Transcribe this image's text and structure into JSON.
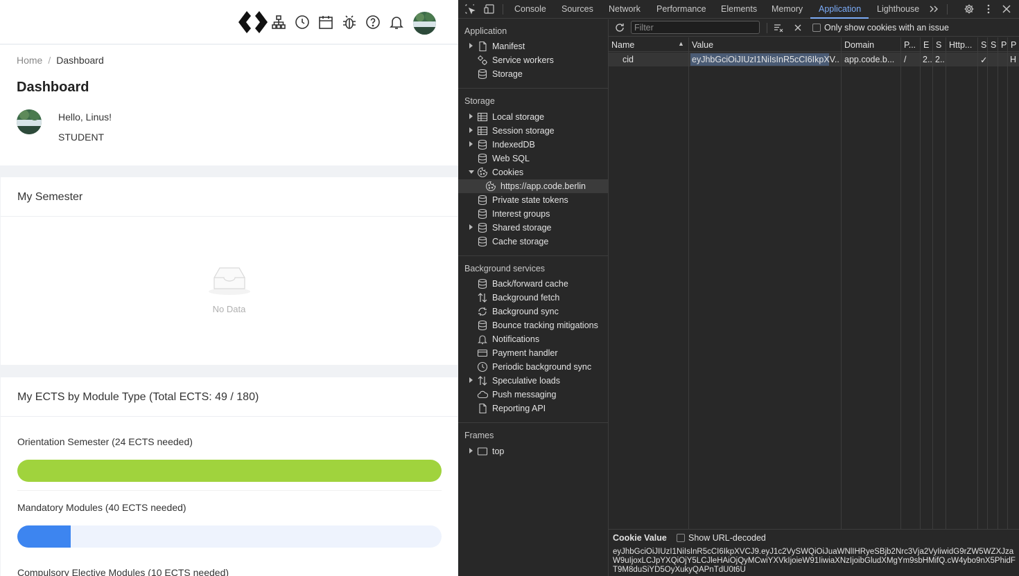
{
  "app": {
    "breadcrumb": {
      "home": "Home",
      "separator": "/",
      "current": "Dashboard"
    },
    "page_title": "Dashboard",
    "profile": {
      "greeting": "Hello, Linus!",
      "role": "STUDENT"
    },
    "semester_card": {
      "title": "My Semester",
      "empty_text": "No Data"
    },
    "ects_card": {
      "title": "My ECTS by Module Type (Total ECTS: 49 / 180)",
      "modules": [
        {
          "label": "Orientation Semester (24 ECTS needed)",
          "progress": 1.0,
          "color": "#a0d33d"
        },
        {
          "label": "Mandatory Modules (40 ECTS needed)",
          "progress": 0.125,
          "color": "#3d85f0"
        },
        {
          "label": "Compulsory Elective Modules (10 ECTS needed)"
        }
      ]
    },
    "colors": {
      "accent_green": "#a0d33d",
      "accent_blue": "#3d85f0",
      "bar_track": "#eef3fd"
    }
  },
  "devtools": {
    "tabs": [
      "Console",
      "Sources",
      "Network",
      "Performance",
      "Elements",
      "Memory",
      "Application",
      "Lighthouse"
    ],
    "active_tab": "Application",
    "sidebar": {
      "application": {
        "title": "Application",
        "items": [
          "Manifest",
          "Service workers",
          "Storage"
        ]
      },
      "storage": {
        "title": "Storage",
        "items": [
          "Local storage",
          "Session storage",
          "IndexedDB",
          "Web SQL",
          "Cookies",
          "https://app.code.berlin",
          "Private state tokens",
          "Interest groups",
          "Shared storage",
          "Cache storage"
        ]
      },
      "background": {
        "title": "Background services",
        "items": [
          "Back/forward cache",
          "Background fetch",
          "Background sync",
          "Bounce tracking mitigations",
          "Notifications",
          "Payment handler",
          "Periodic background sync",
          "Speculative loads",
          "Push messaging",
          "Reporting API"
        ]
      },
      "frames": {
        "title": "Frames",
        "items": [
          "top"
        ]
      }
    },
    "toolbar": {
      "filter_placeholder": "Filter",
      "only_issue_label": "Only show cookies with an issue"
    },
    "columns": [
      "Name",
      "Value",
      "Domain",
      "P...",
      "E",
      "S",
      "Http...",
      "S",
      "S",
      "P",
      "P"
    ],
    "row": {
      "name": "cid",
      "value": "eyJhbGciOiJIUzI1NiIsInR5cCI6IkpXV...",
      "domain": "app.code.b...",
      "path": "/",
      "expires": "2..",
      "size": "2..",
      "secure": "✓",
      "priority": "H"
    },
    "cookie_value": {
      "title": "Cookie Value",
      "show_decoded_label": "Show URL-decoded",
      "text": "eyJhbGciOiJIUzI1NiIsInR5cCI6IkpXVCJ9.eyJ1c2VySWQiOiJuaWNlIHRyeSBjb2Nrc3Vja2VyIiwidG9rZW5WZXJzaW9uIjoxLCJpYXQiOjY5LCJleHAiOjQyMCwiYXVkIjoieW91IiwiaXNzIjoibGludXMgYm9sbHMifQ.cW4ybo9nX5PhidFT9M8duSiYD5OyXukyQAPnTdU0t6U"
    }
  }
}
